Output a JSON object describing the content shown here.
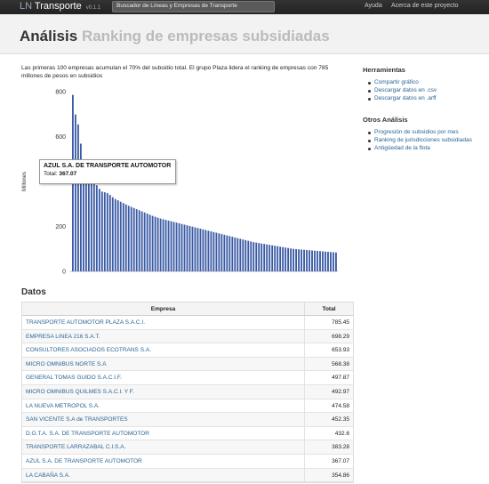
{
  "navbar": {
    "brand_prefix": "LN",
    "brand_name": "Transporte",
    "version": "v0.1.1",
    "search_placeholder": "Buscador de Líneas y Empresas de Transporte",
    "links": [
      "Ayuda",
      "Acerca de este proyecto"
    ]
  },
  "header": {
    "title_main": "Análisis",
    "title_sub": "Ranking de empresas subsidiadas"
  },
  "intro": "Las primeras 100 empresas acumulan el 70% del subsidio total. El grupo Plaza lidera el ranking de empresas con 785 millones de pesos en subsidios",
  "tooltip": {
    "name": "AZUL S.A. DE TRANSPORTE AUTOMOTOR",
    "total_label": "Total:",
    "total_value": "367.07"
  },
  "sidebar": {
    "herramientas_title": "Herramientas",
    "herramientas": [
      "Compartir gráfico",
      "Descargar datos en .csv",
      "Descargar datos en .arff"
    ],
    "otros_title": "Otros Análisis",
    "otros": [
      "Progresión de subsidios por mes",
      "Ranking de jurisdicciones subsidiadas",
      "Antigüedad de la flota"
    ]
  },
  "datos": {
    "title": "Datos",
    "col_empresa": "Empresa",
    "col_total": "Total",
    "rows": [
      {
        "empresa": "TRANSPORTE AUTOMOTOR PLAZA S.A.C.I.",
        "total": "785.45"
      },
      {
        "empresa": "EMPRESA LINEA 216 S.A.T.",
        "total": "698.29"
      },
      {
        "empresa": "CONSULTORES ASOCIADOS ECOTRANS S.A.",
        "total": "653.93"
      },
      {
        "empresa": "MICRO OMNIBUS NORTE S.A",
        "total": "568.38"
      },
      {
        "empresa": "GENERAL TOMAS GUIDO S.A.C.I.F.",
        "total": "497.87"
      },
      {
        "empresa": "MICRO OMNIBUS QUILMES S.A.C.I. Y F.",
        "total": "492.97"
      },
      {
        "empresa": "LA NUEVA METROPOL S.A.",
        "total": "474.58"
      },
      {
        "empresa": "SAN VICENTE S.A de TRANSPORTES",
        "total": "452.35"
      },
      {
        "empresa": "D.O.T.A. S.A. DE TRANSPORTE AUTOMOTOR",
        "total": "432.6"
      },
      {
        "empresa": "TRANSPORTE LARRAZABAL C.I.S.A.",
        "total": "383.28"
      },
      {
        "empresa": "AZUL S.A. DE TRANSPORTE AUTOMOTOR",
        "total": "367.07"
      },
      {
        "empresa": "LA CABAÑA S.A.",
        "total": "354.86"
      }
    ]
  },
  "chart_data": {
    "type": "bar",
    "ylabel": "Millones",
    "ylim": [
      0,
      800
    ],
    "yticks": [
      0,
      200,
      400,
      600,
      800
    ],
    "bar_color": "#3b5ba6",
    "values": [
      785.45,
      698.29,
      653.93,
      568.38,
      497.87,
      492.97,
      474.58,
      452.35,
      432.6,
      383.28,
      367.07,
      354.86,
      352,
      348,
      340,
      330,
      322,
      316,
      310,
      304,
      298,
      292,
      287,
      282,
      277,
      272,
      267,
      262,
      257,
      252,
      247,
      243,
      239,
      235,
      232,
      229,
      226,
      223,
      220,
      217,
      214,
      211,
      208,
      205,
      202,
      199,
      196,
      193,
      190,
      187,
      184,
      181,
      178,
      175,
      172,
      169,
      166,
      163,
      160,
      157,
      154,
      151,
      148,
      145,
      142,
      139,
      136,
      133,
      130,
      128,
      126,
      124,
      122,
      120,
      118,
      116,
      114,
      112,
      110,
      108,
      106,
      104,
      102,
      100,
      99,
      98,
      97,
      96,
      95,
      94,
      93,
      92,
      91,
      90,
      89,
      88,
      87,
      86,
      85,
      84
    ]
  }
}
